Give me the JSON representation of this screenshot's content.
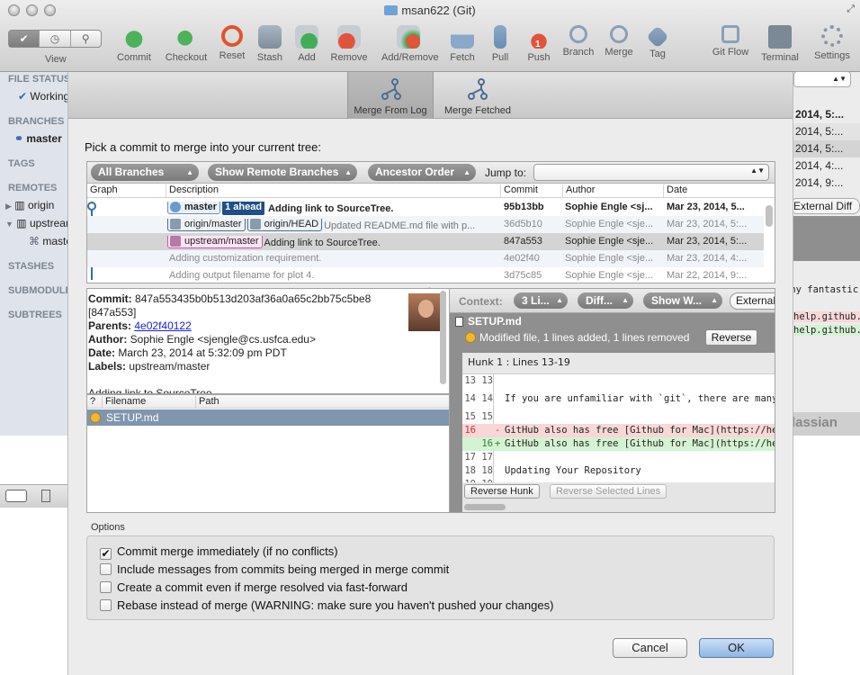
{
  "window": {
    "title": "msan622 (Git)"
  },
  "toolbar": {
    "view_label": "View",
    "items": [
      {
        "label": "Commit"
      },
      {
        "label": "Checkout"
      },
      {
        "label": "Reset"
      },
      {
        "label": "Stash"
      },
      {
        "label": "Add"
      },
      {
        "label": "Remove"
      },
      {
        "label": "Add/Remove"
      },
      {
        "label": "Fetch"
      },
      {
        "label": "Pull"
      },
      {
        "label": "Push"
      },
      {
        "label": "Branch"
      },
      {
        "label": "Merge"
      },
      {
        "label": "Tag"
      },
      {
        "label": "Git Flow"
      },
      {
        "label": "Terminal"
      },
      {
        "label": "Settings"
      }
    ],
    "push_badge": "1"
  },
  "sidebar": {
    "file_status": "FILE STATUS",
    "working": "Working",
    "branches": "BRANCHES",
    "master": "master",
    "tags": "TAGS",
    "remotes": "REMOTES",
    "origin": "origin",
    "upstream": "upstream",
    "upstream_child": "master",
    "stashes": "STASHES",
    "submodules": "SUBMODULES",
    "subtrees": "SUBTREES"
  },
  "background": {
    "rows": [
      "2014, 5:...",
      "2014, 5:...",
      "2014, 5:...",
      "2014, 4:...",
      "2014, 9:..."
    ],
    "external_diff": "External Diff",
    "line1": "any fantastic",
    "line2": "help.github.",
    "line3": "help.github.",
    "brand": "lassian"
  },
  "sheet": {
    "tabs": [
      {
        "label": "Merge From Log"
      },
      {
        "label": "Merge Fetched"
      }
    ],
    "prompt": "Pick a commit to merge into your current tree:",
    "filters": {
      "branches": "All Branches",
      "remote": "Show Remote Branches",
      "order": "Ancestor Order",
      "jump_label": "Jump to:"
    },
    "columns": {
      "graph": "Graph",
      "description": "Description",
      "commit": "Commit",
      "author": "Author",
      "date": "Date"
    },
    "commits": [
      {
        "tag1": "master",
        "ahead": "1 ahead",
        "desc": "Adding link to SourceTree.",
        "commit": "95b13bb",
        "author": "Sophie Engle <sj...",
        "date": "Mar 23, 2014, 5..."
      },
      {
        "tag1": "origin/master",
        "tag2": "origin/HEAD",
        "desc": "Updated README.md file with p...",
        "commit": "36d5b10",
        "author": "Sophie Engle <sje...",
        "date": "Mar 23, 2014, 5:..."
      },
      {
        "tag1": "upstream/master",
        "desc": "Adding link to SourceTree.",
        "commit": "847a553",
        "author": "Sophie Engle <sje...",
        "date": "Mar 23, 2014, 5:..."
      },
      {
        "desc": "Adding customization requirement.",
        "commit": "4e02f40",
        "author": "Sophie Engle <sje...",
        "date": "Mar 23, 2014, 4:..."
      },
      {
        "desc": "Adding output filename for plot 4.",
        "commit": "3d75c85",
        "author": "Sophie Engle <sje...",
        "date": "Mar 22, 2014, 9:..."
      }
    ],
    "detail": {
      "commit_label": "Commit:",
      "commit_hash": "847a553435b0b513d203af36a0a65c2bb75c5be8",
      "commit_short": "[847a553]",
      "parents_label": "Parents:",
      "parent": "4e02f40122",
      "author_label": "Author:",
      "author": "Sophie Engle <sjengle@cs.usfca.edu>",
      "date_label": "Date:",
      "date": "March 23, 2014 at 5:32:09 pm PDT",
      "labels_label": "Labels:",
      "labels": "upstream/master",
      "message": "Adding link to SourceTree."
    },
    "files": {
      "col_status": "?",
      "col_filename": "Filename",
      "col_path": "Path",
      "rows": [
        {
          "name": "SETUP.md"
        }
      ]
    },
    "diff": {
      "context_label": "Context:",
      "context_value": "3 Li...",
      "diff_mode": "Diff...",
      "show_ws": "Show W...",
      "external": "External",
      "file": "SETUP.md",
      "summary": "Modified file, 1 lines added, 1 lines removed",
      "reverse": "Reverse",
      "hunk_title": "Hunk 1 : Lines 13-19",
      "lines": [
        {
          "n1": "13",
          "n2": "13",
          "sign": "",
          "text": "",
          "type": "ctx"
        },
        {
          "n1": "14",
          "n2": "14",
          "sign": "",
          "text": "If you are unfamiliar with `git`, there are many f",
          "type": "ctx"
        },
        {
          "n1": "15",
          "n2": "15",
          "sign": "",
          "text": "",
          "type": "ctx"
        },
        {
          "n1": "16",
          "n2": "",
          "sign": "-",
          "text": "GitHub also has free [Github for Mac](https://help",
          "type": "del"
        },
        {
          "n1": "",
          "n2": "16",
          "sign": "+",
          "text": "GitHub also has free [Github for Mac](https://help",
          "type": "add"
        },
        {
          "n1": "17",
          "n2": "17",
          "sign": "",
          "text": "",
          "type": "ctx"
        },
        {
          "n1": "18",
          "n2": "18",
          "sign": "",
          "text": "Updating Your Repository",
          "type": "ctx"
        },
        {
          "n1": "19",
          "n2": "19",
          "sign": "",
          "text": "------------------------------",
          "type": "ctx"
        }
      ],
      "reverse_hunk": "Reverse Hunk",
      "reverse_selected": "Reverse Selected Lines"
    },
    "options": {
      "title": "Options",
      "items": [
        {
          "label": "Commit merge immediately (if no conflicts)",
          "checked": true
        },
        {
          "label": "Include messages from commits being merged in merge commit",
          "checked": false
        },
        {
          "label": "Create a commit even if merge resolved via fast-forward",
          "checked": false
        },
        {
          "label": "Rebase instead of merge (WARNING: make sure you haven't pushed your changes)",
          "checked": false
        }
      ]
    },
    "cancel": "Cancel",
    "ok": "OK"
  },
  "colors": {
    "graph_blue": "#2f6fae",
    "graph_magenta": "#c2409a",
    "accent": "#1f4f86"
  }
}
